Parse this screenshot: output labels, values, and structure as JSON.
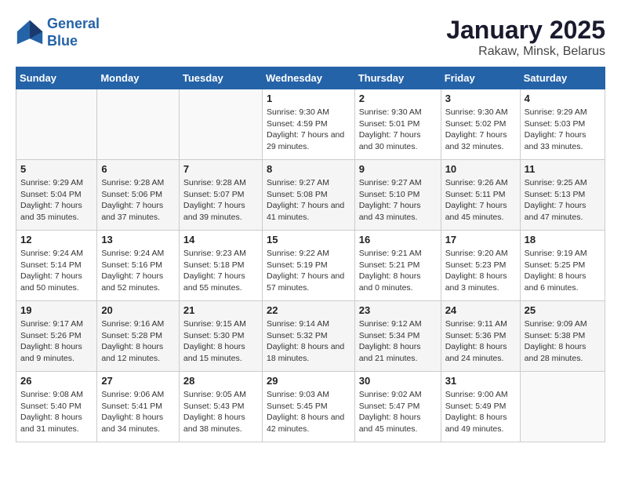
{
  "header": {
    "logo_line1": "General",
    "logo_line2": "Blue",
    "title": "January 2025",
    "subtitle": "Rakaw, Minsk, Belarus"
  },
  "weekdays": [
    "Sunday",
    "Monday",
    "Tuesday",
    "Wednesday",
    "Thursday",
    "Friday",
    "Saturday"
  ],
  "weeks": [
    [
      {
        "day": "",
        "info": ""
      },
      {
        "day": "",
        "info": ""
      },
      {
        "day": "",
        "info": ""
      },
      {
        "day": "1",
        "info": "Sunrise: 9:30 AM\nSunset: 4:59 PM\nDaylight: 7 hours and 29 minutes."
      },
      {
        "day": "2",
        "info": "Sunrise: 9:30 AM\nSunset: 5:01 PM\nDaylight: 7 hours and 30 minutes."
      },
      {
        "day": "3",
        "info": "Sunrise: 9:30 AM\nSunset: 5:02 PM\nDaylight: 7 hours and 32 minutes."
      },
      {
        "day": "4",
        "info": "Sunrise: 9:29 AM\nSunset: 5:03 PM\nDaylight: 7 hours and 33 minutes."
      }
    ],
    [
      {
        "day": "5",
        "info": "Sunrise: 9:29 AM\nSunset: 5:04 PM\nDaylight: 7 hours and 35 minutes."
      },
      {
        "day": "6",
        "info": "Sunrise: 9:28 AM\nSunset: 5:06 PM\nDaylight: 7 hours and 37 minutes."
      },
      {
        "day": "7",
        "info": "Sunrise: 9:28 AM\nSunset: 5:07 PM\nDaylight: 7 hours and 39 minutes."
      },
      {
        "day": "8",
        "info": "Sunrise: 9:27 AM\nSunset: 5:08 PM\nDaylight: 7 hours and 41 minutes."
      },
      {
        "day": "9",
        "info": "Sunrise: 9:27 AM\nSunset: 5:10 PM\nDaylight: 7 hours and 43 minutes."
      },
      {
        "day": "10",
        "info": "Sunrise: 9:26 AM\nSunset: 5:11 PM\nDaylight: 7 hours and 45 minutes."
      },
      {
        "day": "11",
        "info": "Sunrise: 9:25 AM\nSunset: 5:13 PM\nDaylight: 7 hours and 47 minutes."
      }
    ],
    [
      {
        "day": "12",
        "info": "Sunrise: 9:24 AM\nSunset: 5:14 PM\nDaylight: 7 hours and 50 minutes."
      },
      {
        "day": "13",
        "info": "Sunrise: 9:24 AM\nSunset: 5:16 PM\nDaylight: 7 hours and 52 minutes."
      },
      {
        "day": "14",
        "info": "Sunrise: 9:23 AM\nSunset: 5:18 PM\nDaylight: 7 hours and 55 minutes."
      },
      {
        "day": "15",
        "info": "Sunrise: 9:22 AM\nSunset: 5:19 PM\nDaylight: 7 hours and 57 minutes."
      },
      {
        "day": "16",
        "info": "Sunrise: 9:21 AM\nSunset: 5:21 PM\nDaylight: 8 hours and 0 minutes."
      },
      {
        "day": "17",
        "info": "Sunrise: 9:20 AM\nSunset: 5:23 PM\nDaylight: 8 hours and 3 minutes."
      },
      {
        "day": "18",
        "info": "Sunrise: 9:19 AM\nSunset: 5:25 PM\nDaylight: 8 hours and 6 minutes."
      }
    ],
    [
      {
        "day": "19",
        "info": "Sunrise: 9:17 AM\nSunset: 5:26 PM\nDaylight: 8 hours and 9 minutes."
      },
      {
        "day": "20",
        "info": "Sunrise: 9:16 AM\nSunset: 5:28 PM\nDaylight: 8 hours and 12 minutes."
      },
      {
        "day": "21",
        "info": "Sunrise: 9:15 AM\nSunset: 5:30 PM\nDaylight: 8 hours and 15 minutes."
      },
      {
        "day": "22",
        "info": "Sunrise: 9:14 AM\nSunset: 5:32 PM\nDaylight: 8 hours and 18 minutes."
      },
      {
        "day": "23",
        "info": "Sunrise: 9:12 AM\nSunset: 5:34 PM\nDaylight: 8 hours and 21 minutes."
      },
      {
        "day": "24",
        "info": "Sunrise: 9:11 AM\nSunset: 5:36 PM\nDaylight: 8 hours and 24 minutes."
      },
      {
        "day": "25",
        "info": "Sunrise: 9:09 AM\nSunset: 5:38 PM\nDaylight: 8 hours and 28 minutes."
      }
    ],
    [
      {
        "day": "26",
        "info": "Sunrise: 9:08 AM\nSunset: 5:40 PM\nDaylight: 8 hours and 31 minutes."
      },
      {
        "day": "27",
        "info": "Sunrise: 9:06 AM\nSunset: 5:41 PM\nDaylight: 8 hours and 34 minutes."
      },
      {
        "day": "28",
        "info": "Sunrise: 9:05 AM\nSunset: 5:43 PM\nDaylight: 8 hours and 38 minutes."
      },
      {
        "day": "29",
        "info": "Sunrise: 9:03 AM\nSunset: 5:45 PM\nDaylight: 8 hours and 42 minutes."
      },
      {
        "day": "30",
        "info": "Sunrise: 9:02 AM\nSunset: 5:47 PM\nDaylight: 8 hours and 45 minutes."
      },
      {
        "day": "31",
        "info": "Sunrise: 9:00 AM\nSunset: 5:49 PM\nDaylight: 8 hours and 49 minutes."
      },
      {
        "day": "",
        "info": ""
      }
    ]
  ]
}
